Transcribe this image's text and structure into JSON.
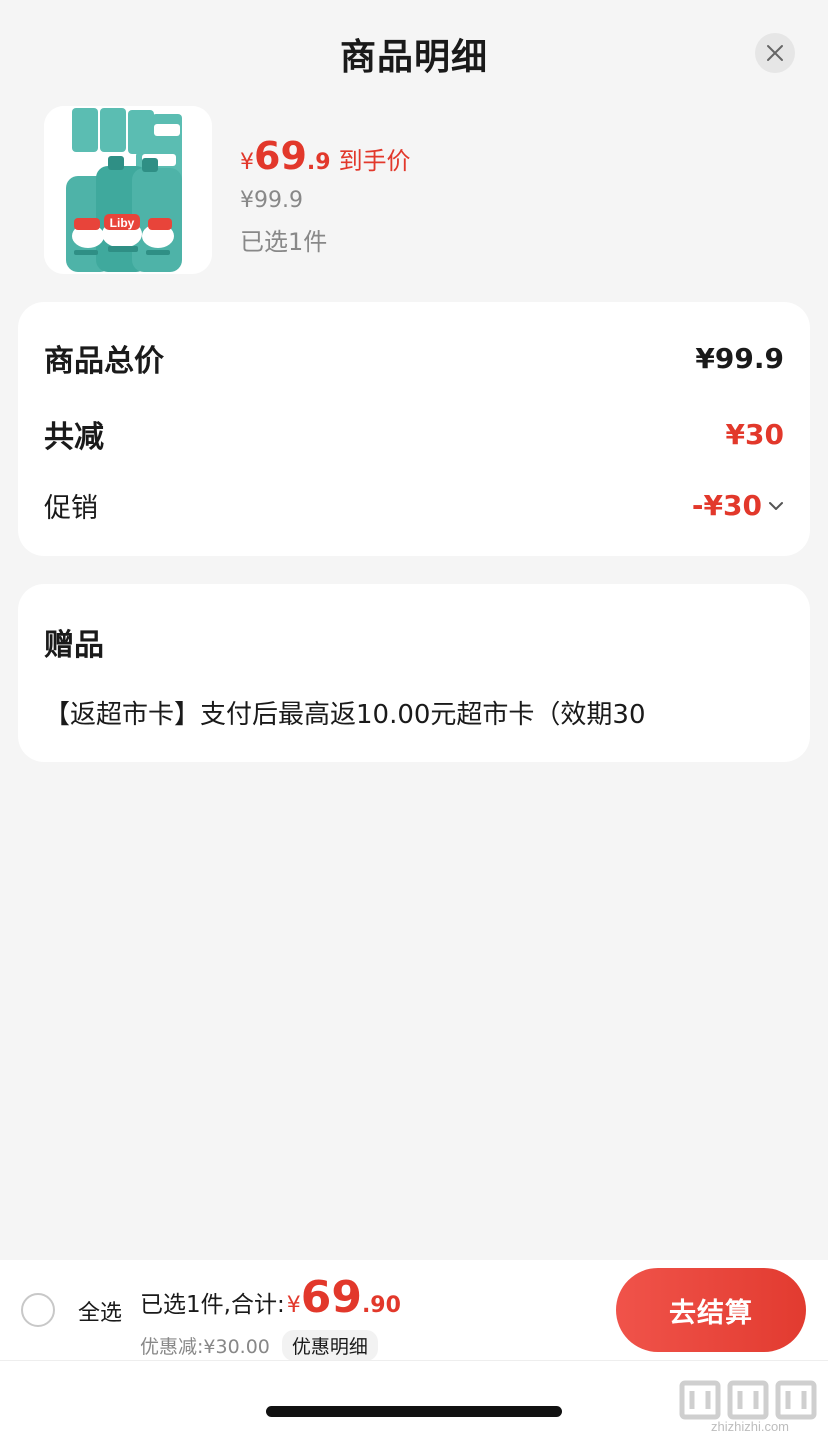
{
  "header": {
    "title": "商品明细"
  },
  "product": {
    "price_currency": "¥",
    "price_int": "69",
    "price_dec": ".9",
    "price_tag": "到手价",
    "original_price": "¥99.9",
    "selected": "已选1件",
    "brand_logo": "Liby"
  },
  "summary": {
    "total_label": "商品总价",
    "total_value": "¥99.9",
    "reduce_label": "共减",
    "reduce_value": "¥30",
    "promo_label": "促销",
    "promo_value": "-¥30"
  },
  "gift": {
    "title": "赠品",
    "text": "【返超市卡】支付后最高返10.00元超市卡（效期30"
  },
  "bottom": {
    "select_all": "全选",
    "sum_label": "已选1件,合计:",
    "sum_currency": "¥",
    "sum_int": "69",
    "sum_dec": ".90",
    "discount_text": "优惠减:¥30.00",
    "discount_detail": "优惠明细",
    "checkout": "去结算"
  },
  "watermark": {
    "text": "zhizhizhi.com"
  },
  "colors": {
    "accent_red": "#e2382b",
    "background": "#f5f5f5",
    "card": "#ffffff",
    "muted": "#888888"
  },
  "icons": {
    "close": "close-icon",
    "chevron": "chevron-down-icon",
    "radio": "radio-unchecked-icon"
  }
}
